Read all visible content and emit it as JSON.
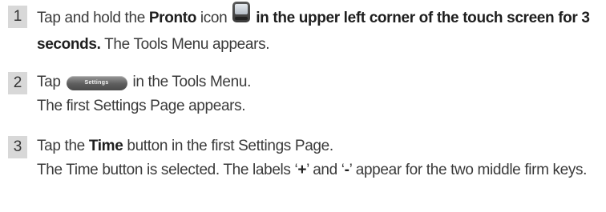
{
  "steps": [
    {
      "number": "1",
      "parts": {
        "t1": "Tap and hold the ",
        "b1": "Pronto",
        "t2": " icon ",
        "t3": " in the upper left corner of the touch screen for 3 seconds.",
        "t4": " The Tools Menu appears."
      },
      "icon": "pronto-device-icon"
    },
    {
      "number": "2",
      "parts": {
        "t1": "Tap ",
        "button": "Settings",
        "t2": " in the Tools Menu.",
        "t3": "The first Settings Page appears."
      }
    },
    {
      "number": "3",
      "parts": {
        "t1": "Tap the ",
        "b1": "Time",
        "t2": " button in the first Settings Page.",
        "t3": "The Time button is selected. The labels ‘",
        "b2": "+",
        "t4": "’ and ‘",
        "b3": "-",
        "t5": "’ appear for the two middle firm keys."
      }
    }
  ]
}
